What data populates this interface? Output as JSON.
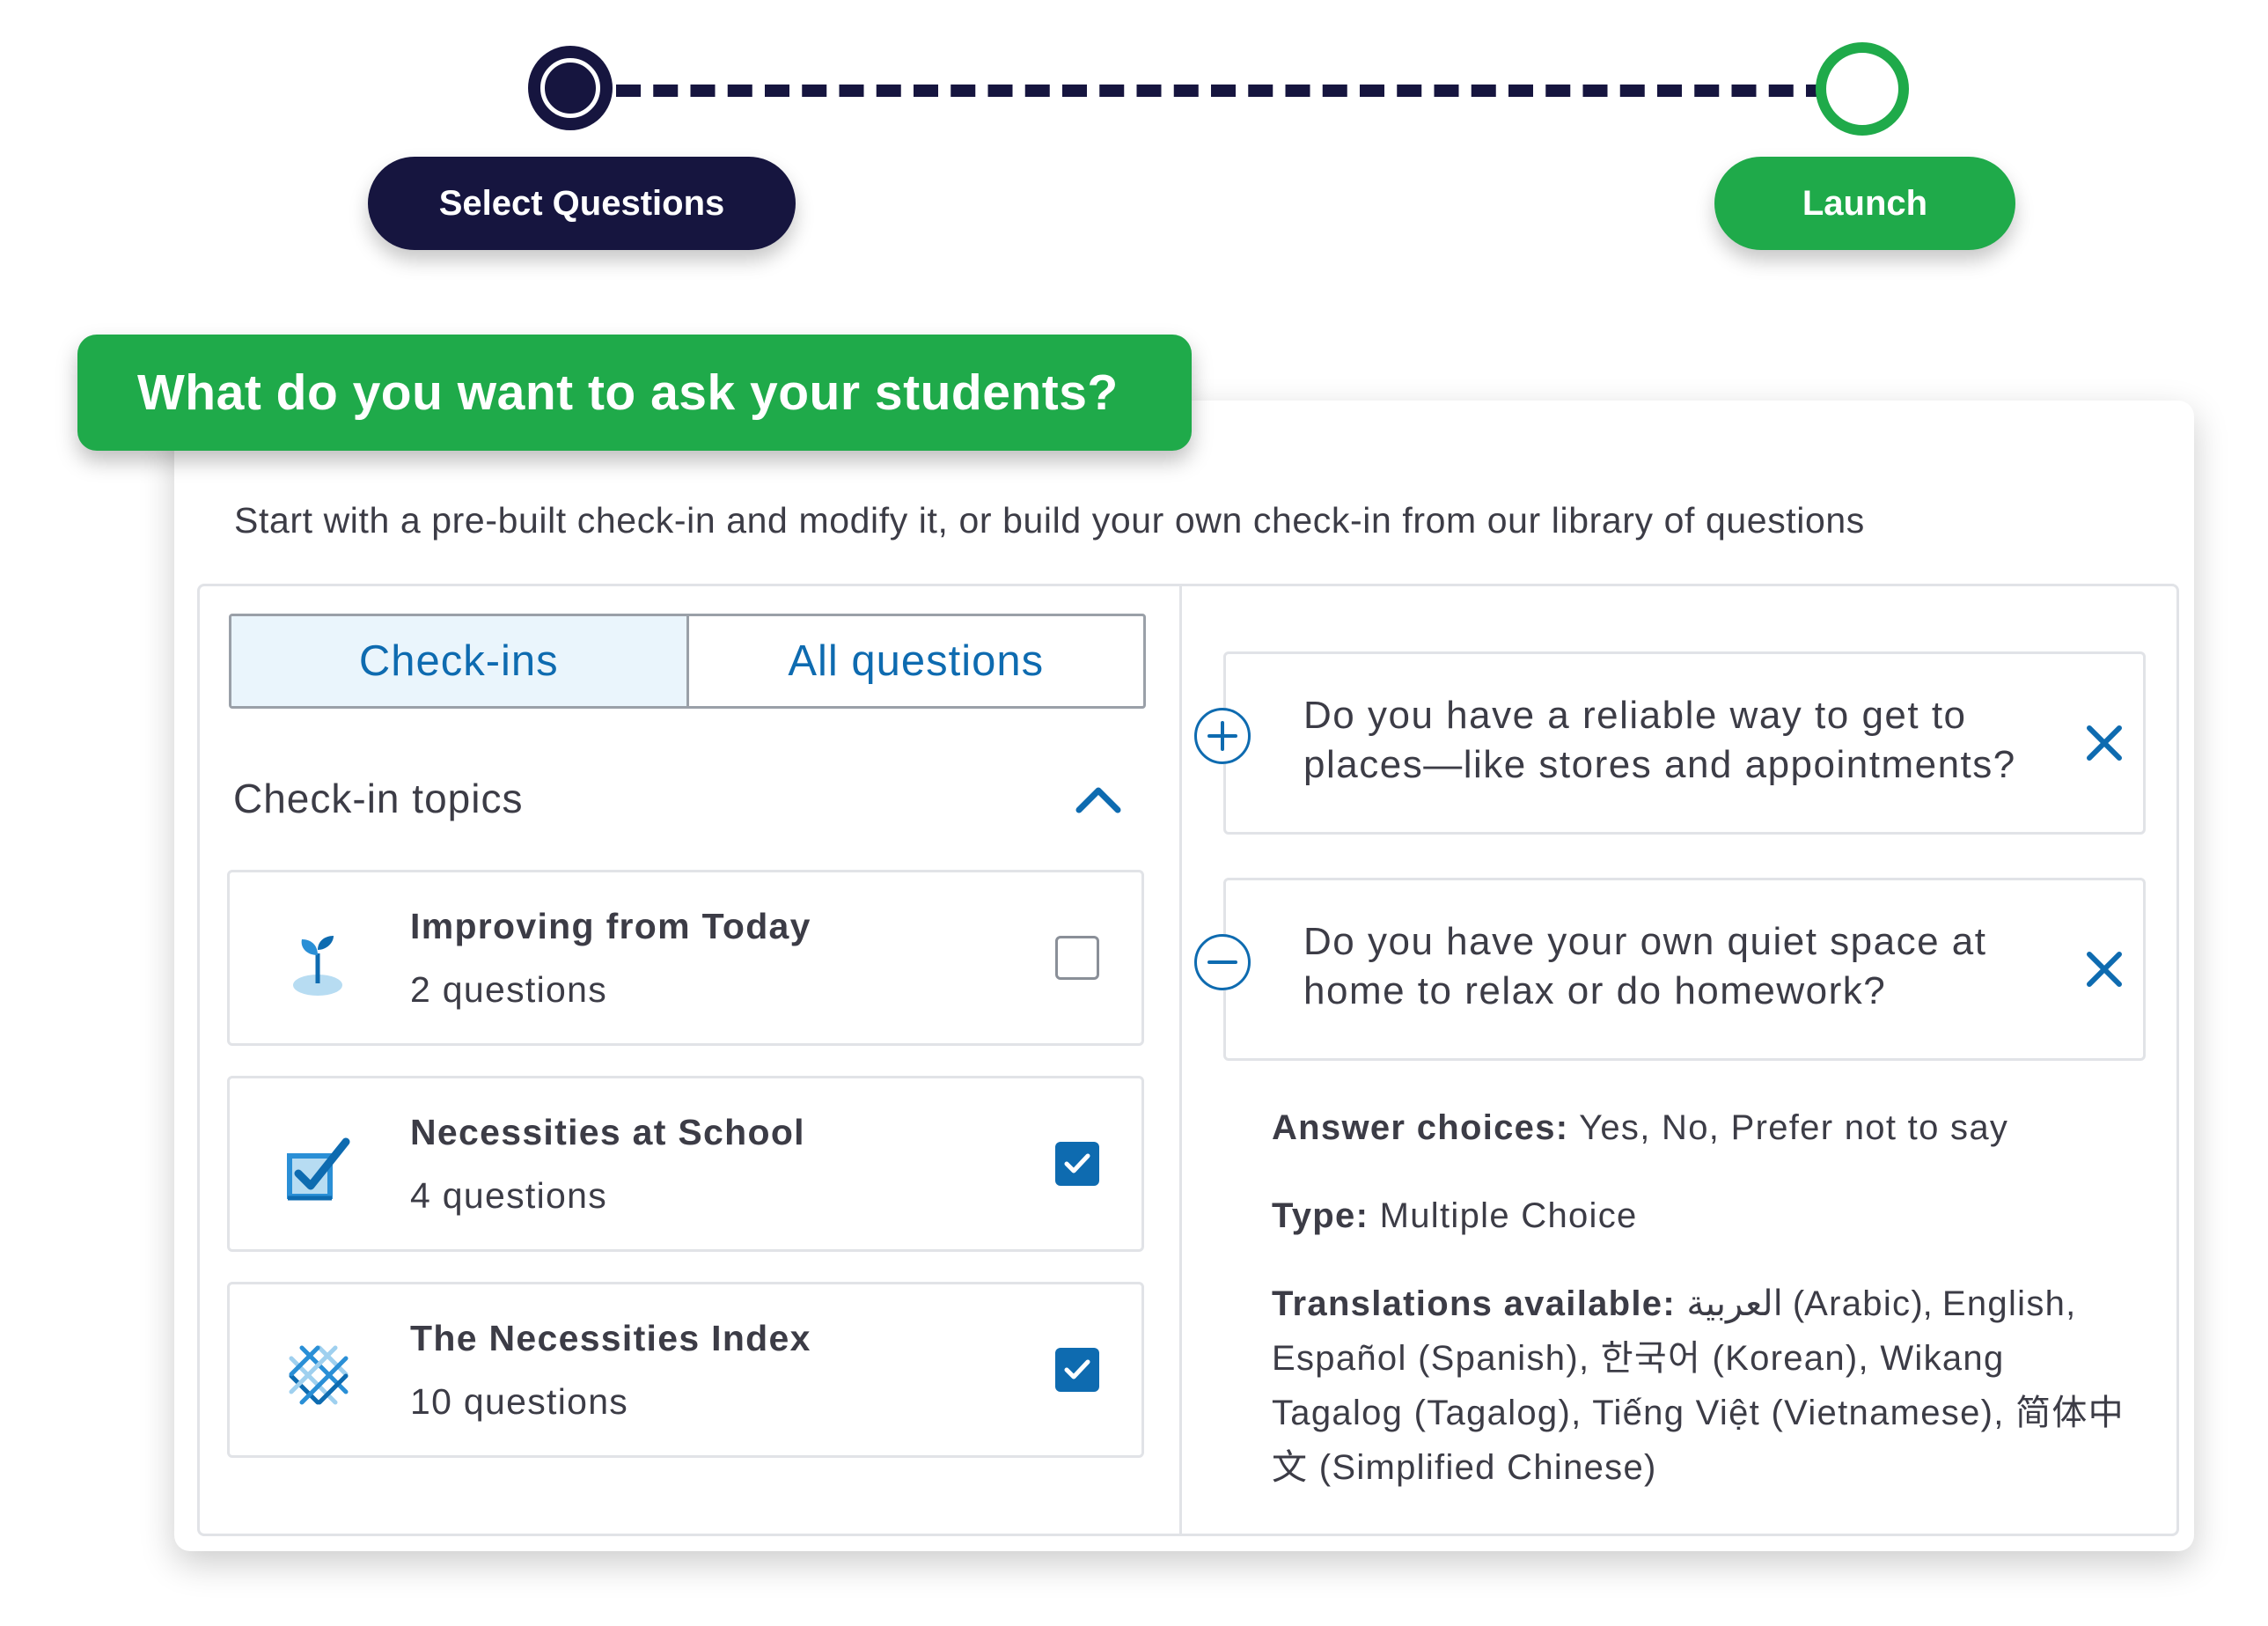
{
  "stepper": {
    "steps": [
      {
        "label": "Select Questions",
        "color": "#16153f"
      },
      {
        "label": "Launch",
        "color": "#1faa4a"
      }
    ]
  },
  "banner": {
    "title": "What do you want to ask your students?"
  },
  "intro": "Start with a pre-built check-in and modify it, or build your own check-in from our library of questions",
  "tabs": [
    {
      "label": "Check-ins",
      "active": true
    },
    {
      "label": "All questions",
      "active": false
    }
  ],
  "topics_heading": "Check-in topics",
  "topics": [
    {
      "name": "Improving from Today",
      "count": "2 questions",
      "checked": false,
      "icon": "sprout-icon"
    },
    {
      "name": "Necessities at School",
      "count": "4 questions",
      "checked": true,
      "icon": "checked-box-icon"
    },
    {
      "name": "The Necessities Index",
      "count": "10 questions",
      "checked": true,
      "icon": "crossed-lines-icon"
    }
  ],
  "questions": [
    {
      "text": "Do you have a reliable way to get to places—like stores and appointments?",
      "expanded": false
    },
    {
      "text": "Do you have your own quiet space at home to relax or do homework?",
      "expanded": true
    }
  ],
  "details": {
    "answer_label": "Answer choices:",
    "answer_value": " Yes, No, Prefer not to say",
    "type_label": "Type:",
    "type_value": " Multiple Choice",
    "translations_label": "Translations available:",
    "translations_value": " العربية (Arabic), English, Español (Spanish), 한국어 (Korean), Wikang Tagalog (Tagalog), Tiếng Việt (Vietnamese), 简体中文 (Simplified Chinese)"
  },
  "colors": {
    "navy": "#16153f",
    "green": "#1faa4a",
    "blue": "#0e6bb0"
  }
}
